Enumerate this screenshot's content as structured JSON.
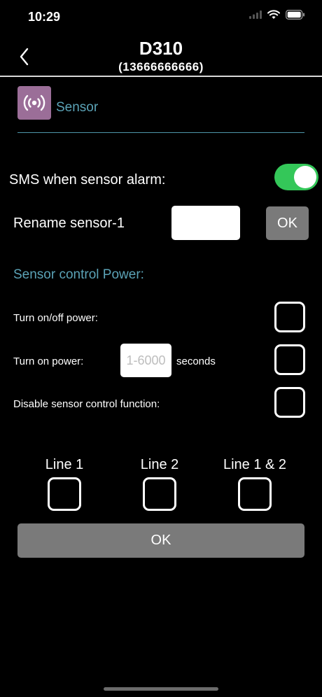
{
  "status_bar": {
    "time": "10:29"
  },
  "nav": {
    "title": "D310",
    "subtitle": "(13666666666)"
  },
  "sensor_header": {
    "label": "Sensor",
    "icon": "sensor-signal-icon",
    "tile_color": "#9b6e98"
  },
  "sms_alarm": {
    "label": "SMS when sensor alarm:",
    "enabled": true,
    "toggle_color": "#34c759"
  },
  "rename": {
    "label": "Rename sensor-1",
    "value": "",
    "ok_label": "OK"
  },
  "control": {
    "title": "Sensor control Power:",
    "rows": [
      {
        "label": "Turn on/off power:",
        "checked": false
      },
      {
        "label": "Turn on power:",
        "placeholder": "1-6000",
        "unit": "seconds",
        "checked": false
      },
      {
        "label": "Disable sensor control function:",
        "checked": false
      }
    ]
  },
  "lines": [
    {
      "label": "Line 1",
      "checked": false
    },
    {
      "label": "Line 2",
      "checked": false
    },
    {
      "label": "Line 1 & 2",
      "checked": false
    }
  ],
  "submit": {
    "label": "OK"
  },
  "colors": {
    "accent": "#5ba3b7",
    "button_gray": "#7a7a7a"
  }
}
